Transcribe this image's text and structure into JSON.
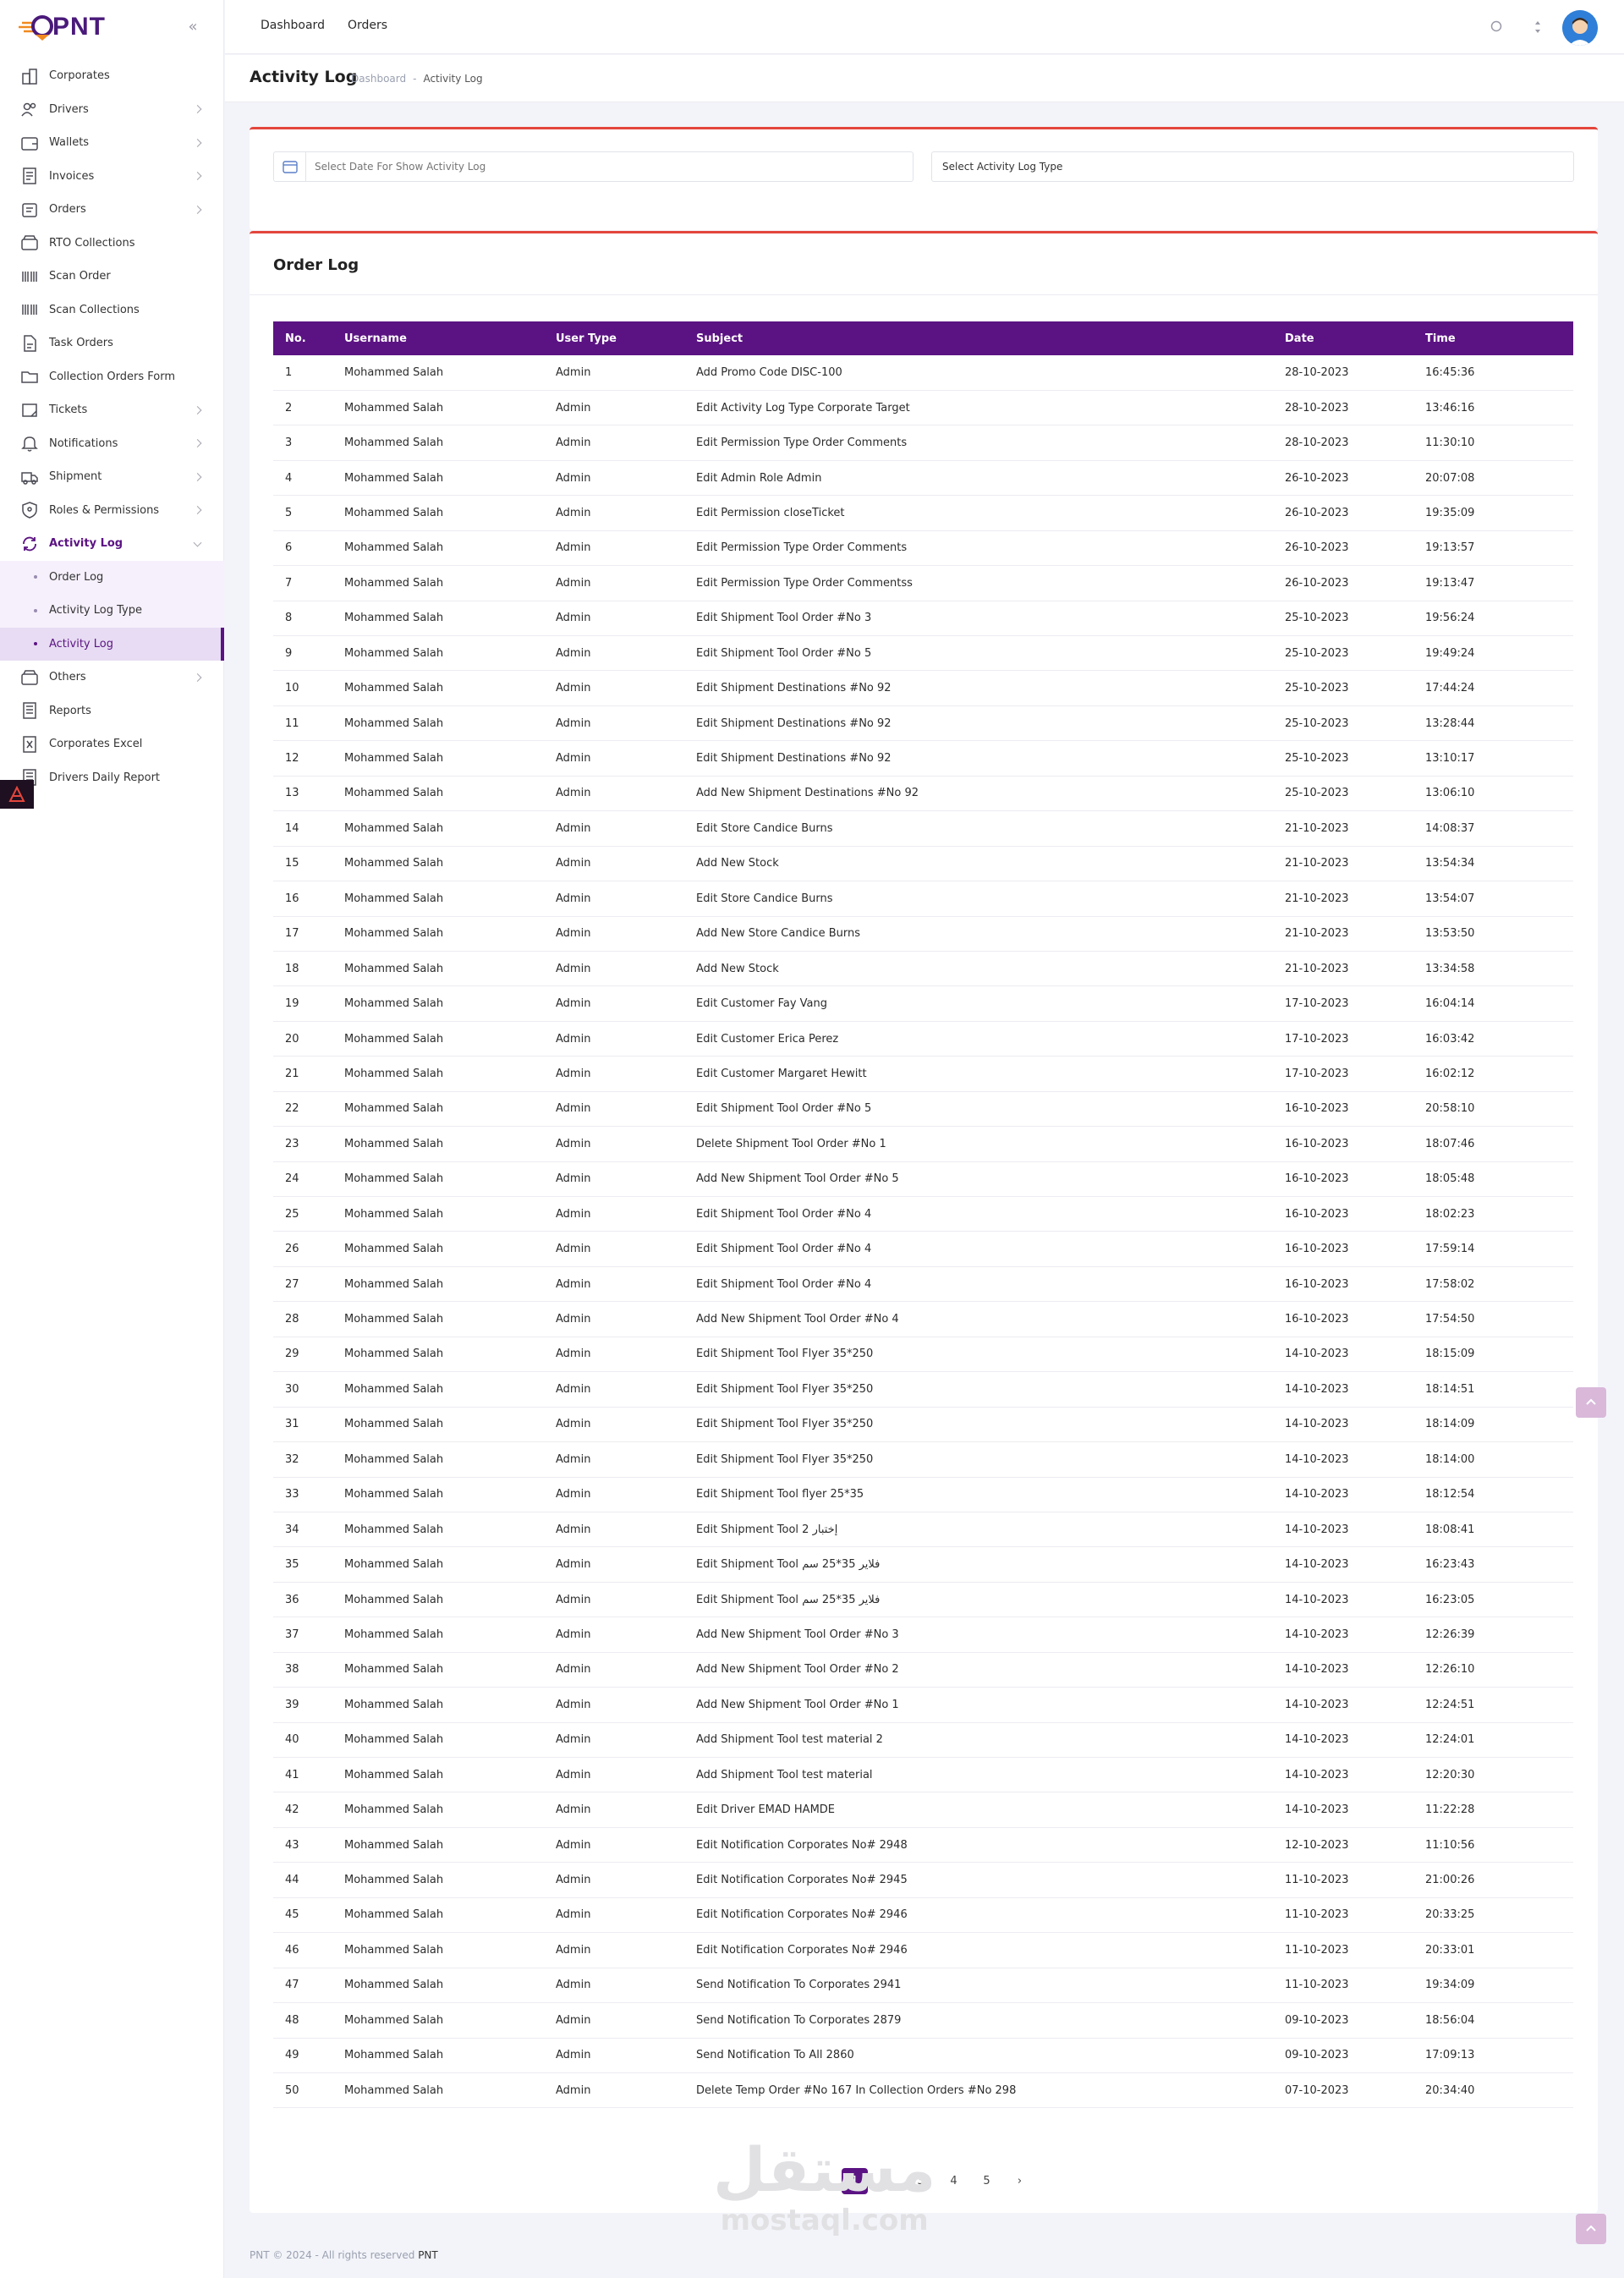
{
  "brand": {
    "name": "PNT"
  },
  "sidebar": {
    "items": [
      {
        "label": "Corporates",
        "icon": "building-icon",
        "chevron": false
      },
      {
        "label": "Drivers",
        "icon": "users-icon",
        "chevron": true
      },
      {
        "label": "Wallets",
        "icon": "wallet-icon",
        "chevron": true
      },
      {
        "label": "Invoices",
        "icon": "invoice-icon",
        "chevron": true
      },
      {
        "label": "Orders",
        "icon": "orders-icon",
        "chevron": true
      },
      {
        "label": "RTO Collections",
        "icon": "box-icon",
        "chevron": false
      },
      {
        "label": "Scan Order",
        "icon": "barcode-icon",
        "chevron": false
      },
      {
        "label": "Scan Collections",
        "icon": "barcode-icon",
        "chevron": false
      },
      {
        "label": "Task Orders",
        "icon": "document-icon",
        "chevron": false
      },
      {
        "label": "Collection Orders Form",
        "icon": "folder-icon",
        "chevron": false
      },
      {
        "label": "Tickets",
        "icon": "ticket-icon",
        "chevron": true
      },
      {
        "label": "Notifications",
        "icon": "bell-icon",
        "chevron": true
      },
      {
        "label": "Shipment",
        "icon": "truck-icon",
        "chevron": true
      },
      {
        "label": "Roles & Permissions",
        "icon": "shield-icon",
        "chevron": true
      },
      {
        "label": "Activity Log",
        "icon": "refresh-icon",
        "chevron": true,
        "active": true
      }
    ],
    "submenu": [
      {
        "label": "Order Log"
      },
      {
        "label": "Activity Log Type"
      },
      {
        "label": "Activity Log",
        "selected": true
      }
    ],
    "items_after": [
      {
        "label": "Others",
        "icon": "box-icon",
        "chevron": true
      },
      {
        "label": "Reports",
        "icon": "report-icon",
        "chevron": false
      },
      {
        "label": "Corporates Excel",
        "icon": "excel-icon",
        "chevron": false
      },
      {
        "label": "Drivers Daily Report",
        "icon": "report-icon",
        "chevron": false
      }
    ]
  },
  "topbar": {
    "links": [
      "Dashboard",
      "Orders"
    ]
  },
  "page": {
    "title": "Activity Log",
    "breadcrumb": [
      "Dashboard",
      "-",
      "Activity Log"
    ]
  },
  "filters": {
    "date_placeholder": "Select Date For Show Activity Log",
    "type_select": "Select Activity Log Type"
  },
  "table": {
    "title": "Order Log",
    "columns": [
      "No.",
      "Username",
      "User Type",
      "Subject",
      "Date",
      "Time"
    ],
    "rows": [
      [
        "1",
        "Mohammed Salah",
        "Admin",
        "Add Promo Code DISC-100",
        "28-10-2023",
        "16:45:36"
      ],
      [
        "2",
        "Mohammed Salah",
        "Admin",
        "Edit Activity Log Type Corporate Target",
        "28-10-2023",
        "13:46:16"
      ],
      [
        "3",
        "Mohammed Salah",
        "Admin",
        "Edit Permission Type Order Comments",
        "28-10-2023",
        "11:30:10"
      ],
      [
        "4",
        "Mohammed Salah",
        "Admin",
        "Edit Admin Role Admin",
        "26-10-2023",
        "20:07:08"
      ],
      [
        "5",
        "Mohammed Salah",
        "Admin",
        "Edit Permission closeTicket",
        "26-10-2023",
        "19:35:09"
      ],
      [
        "6",
        "Mohammed Salah",
        "Admin",
        "Edit Permission Type Order Comments",
        "26-10-2023",
        "19:13:57"
      ],
      [
        "7",
        "Mohammed Salah",
        "Admin",
        "Edit Permission Type Order Commentss",
        "26-10-2023",
        "19:13:47"
      ],
      [
        "8",
        "Mohammed Salah",
        "Admin",
        "Edit Shipment Tool Order #No 3",
        "25-10-2023",
        "19:56:24"
      ],
      [
        "9",
        "Mohammed Salah",
        "Admin",
        "Edit Shipment Tool Order #No 5",
        "25-10-2023",
        "19:49:24"
      ],
      [
        "10",
        "Mohammed Salah",
        "Admin",
        "Edit Shipment Destinations #No 92",
        "25-10-2023",
        "17:44:24"
      ],
      [
        "11",
        "Mohammed Salah",
        "Admin",
        "Edit Shipment Destinations #No 92",
        "25-10-2023",
        "13:28:44"
      ],
      [
        "12",
        "Mohammed Salah",
        "Admin",
        "Edit Shipment Destinations #No 92",
        "25-10-2023",
        "13:10:17"
      ],
      [
        "13",
        "Mohammed Salah",
        "Admin",
        "Add New Shipment Destinations #No 92",
        "25-10-2023",
        "13:06:10"
      ],
      [
        "14",
        "Mohammed Salah",
        "Admin",
        "Edit Store Candice Burns",
        "21-10-2023",
        "14:08:37"
      ],
      [
        "15",
        "Mohammed Salah",
        "Admin",
        "Add New Stock",
        "21-10-2023",
        "13:54:34"
      ],
      [
        "16",
        "Mohammed Salah",
        "Admin",
        "Edit Store Candice Burns",
        "21-10-2023",
        "13:54:07"
      ],
      [
        "17",
        "Mohammed Salah",
        "Admin",
        "Add New Store Candice Burns",
        "21-10-2023",
        "13:53:50"
      ],
      [
        "18",
        "Mohammed Salah",
        "Admin",
        "Add New Stock",
        "21-10-2023",
        "13:34:58"
      ],
      [
        "19",
        "Mohammed Salah",
        "Admin",
        "Edit Customer Fay Vang",
        "17-10-2023",
        "16:04:14"
      ],
      [
        "20",
        "Mohammed Salah",
        "Admin",
        "Edit Customer Erica Perez",
        "17-10-2023",
        "16:03:42"
      ],
      [
        "21",
        "Mohammed Salah",
        "Admin",
        "Edit Customer Margaret Hewitt",
        "17-10-2023",
        "16:02:12"
      ],
      [
        "22",
        "Mohammed Salah",
        "Admin",
        "Edit Shipment Tool Order #No 5",
        "16-10-2023",
        "20:58:10"
      ],
      [
        "23",
        "Mohammed Salah",
        "Admin",
        "Delete Shipment Tool Order #No 1",
        "16-10-2023",
        "18:07:46"
      ],
      [
        "24",
        "Mohammed Salah",
        "Admin",
        "Add New Shipment Tool Order #No 5",
        "16-10-2023",
        "18:05:48"
      ],
      [
        "25",
        "Mohammed Salah",
        "Admin",
        "Edit Shipment Tool Order #No 4",
        "16-10-2023",
        "18:02:23"
      ],
      [
        "26",
        "Mohammed Salah",
        "Admin",
        "Edit Shipment Tool Order #No 4",
        "16-10-2023",
        "17:59:14"
      ],
      [
        "27",
        "Mohammed Salah",
        "Admin",
        "Edit Shipment Tool Order #No 4",
        "16-10-2023",
        "17:58:02"
      ],
      [
        "28",
        "Mohammed Salah",
        "Admin",
        "Add New Shipment Tool Order #No 4",
        "16-10-2023",
        "17:54:50"
      ],
      [
        "29",
        "Mohammed Salah",
        "Admin",
        "Edit Shipment Tool Flyer 35*250",
        "14-10-2023",
        "18:15:09"
      ],
      [
        "30",
        "Mohammed Salah",
        "Admin",
        "Edit Shipment Tool Flyer 35*250",
        "14-10-2023",
        "18:14:51"
      ],
      [
        "31",
        "Mohammed Salah",
        "Admin",
        "Edit Shipment Tool Flyer 35*250",
        "14-10-2023",
        "18:14:09"
      ],
      [
        "32",
        "Mohammed Salah",
        "Admin",
        "Edit Shipment Tool Flyer 35*250",
        "14-10-2023",
        "18:14:00"
      ],
      [
        "33",
        "Mohammed Salah",
        "Admin",
        "Edit Shipment Tool flyer 25*35",
        "14-10-2023",
        "18:12:54"
      ],
      [
        "34",
        "Mohammed Salah",
        "Admin",
        "Edit Shipment Tool 2 إختبار",
        "14-10-2023",
        "18:08:41"
      ],
      [
        "35",
        "Mohammed Salah",
        "Admin",
        "Edit Shipment Tool فلاير 35*25 سم",
        "14-10-2023",
        "16:23:43"
      ],
      [
        "36",
        "Mohammed Salah",
        "Admin",
        "Edit Shipment Tool فلاير 35*25 سم",
        "14-10-2023",
        "16:23:05"
      ],
      [
        "37",
        "Mohammed Salah",
        "Admin",
        "Add New Shipment Tool Order #No 3",
        "14-10-2023",
        "12:26:39"
      ],
      [
        "38",
        "Mohammed Salah",
        "Admin",
        "Add New Shipment Tool Order #No 2",
        "14-10-2023",
        "12:26:10"
      ],
      [
        "39",
        "Mohammed Salah",
        "Admin",
        "Add New Shipment Tool Order #No 1",
        "14-10-2023",
        "12:24:51"
      ],
      [
        "40",
        "Mohammed Salah",
        "Admin",
        "Add Shipment Tool test material 2",
        "14-10-2023",
        "12:24:01"
      ],
      [
        "41",
        "Mohammed Salah",
        "Admin",
        "Add Shipment Tool test material",
        "14-10-2023",
        "12:20:30"
      ],
      [
        "42",
        "Mohammed Salah",
        "Admin",
        "Edit Driver EMAD HAMDE",
        "14-10-2023",
        "11:22:28"
      ],
      [
        "43",
        "Mohammed Salah",
        "Admin",
        "Edit Notification Corporates No# 2948",
        "12-10-2023",
        "11:10:56"
      ],
      [
        "44",
        "Mohammed Salah",
        "Admin",
        "Edit Notification Corporates No# 2945",
        "11-10-2023",
        "21:00:26"
      ],
      [
        "45",
        "Mohammed Salah",
        "Admin",
        "Edit Notification Corporates No# 2946",
        "11-10-2023",
        "20:33:25"
      ],
      [
        "46",
        "Mohammed Salah",
        "Admin",
        "Edit Notification Corporates No# 2946",
        "11-10-2023",
        "20:33:01"
      ],
      [
        "47",
        "Mohammed Salah",
        "Admin",
        "Send Notification To Corporates 2941",
        "11-10-2023",
        "19:34:09"
      ],
      [
        "48",
        "Mohammed Salah",
        "Admin",
        "Send Notification To Corporates 2879",
        "09-10-2023",
        "18:56:04"
      ],
      [
        "49",
        "Mohammed Salah",
        "Admin",
        "Send Notification To All 2860",
        "09-10-2023",
        "17:09:13"
      ],
      [
        "50",
        "Mohammed Salah",
        "Admin",
        "Delete Temp Order #No 167 In Collection Orders #No 298",
        "07-10-2023",
        "20:34:40"
      ]
    ]
  },
  "pagination": {
    "pages": [
      "1",
      "2",
      "3",
      "4",
      "5"
    ],
    "current": "1",
    "next": "›"
  },
  "watermark": {
    "arabic": "مستقل",
    "latin": "mostaql.com"
  },
  "footer": {
    "text": "PNT © 2024 - All rights reserved",
    "brand": "PNT"
  },
  "colors": {
    "primary": "#5b1383",
    "accent_border": "#e3463d",
    "sidebar_active_bg": "#f6f0fc"
  }
}
